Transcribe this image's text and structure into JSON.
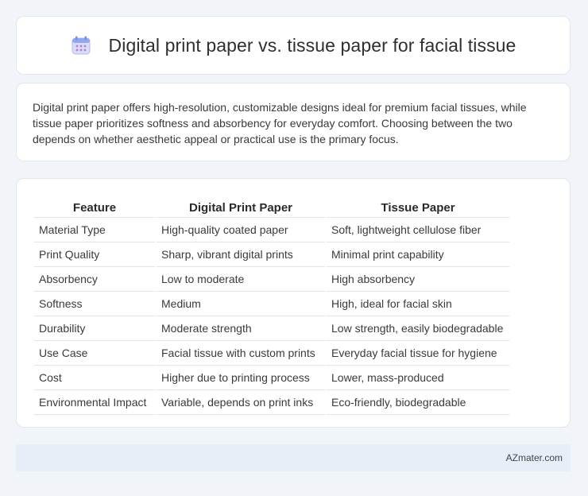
{
  "header": {
    "title": "Digital print paper vs. tissue paper for facial tissue",
    "icon": "calendar-icon"
  },
  "intro": {
    "text": "Digital print paper offers high-resolution, customizable designs ideal for premium facial tissues, while tissue paper prioritizes softness and absorbency for everyday comfort. Choosing between the two depends on whether aesthetic appeal or practical use is the primary focus."
  },
  "table": {
    "headers": [
      "Feature",
      "Digital Print Paper",
      "Tissue Paper"
    ],
    "rows": [
      [
        "Material Type",
        "High-quality coated paper",
        "Soft, lightweight cellulose fiber"
      ],
      [
        "Print Quality",
        "Sharp, vibrant digital prints",
        "Minimal print capability"
      ],
      [
        "Absorbency",
        "Low to moderate",
        "High absorbency"
      ],
      [
        "Softness",
        "Medium",
        "High, ideal for facial skin"
      ],
      [
        "Durability",
        "Moderate strength",
        "Low strength, easily biodegradable"
      ],
      [
        "Use Case",
        "Facial tissue with custom prints",
        "Everyday facial tissue for hygiene"
      ],
      [
        "Cost",
        "Higher due to printing process",
        "Lower, mass-produced"
      ],
      [
        "Environmental Impact",
        "Variable, depends on print inks",
        "Eco-friendly, biodegradable"
      ]
    ]
  },
  "footer": {
    "text": "AZmater.com"
  },
  "colors": {
    "background": "#f1f4f9",
    "card": "#ffffff",
    "footer_bg": "#e8eef8",
    "icon_accent": "#8a7ce0"
  }
}
